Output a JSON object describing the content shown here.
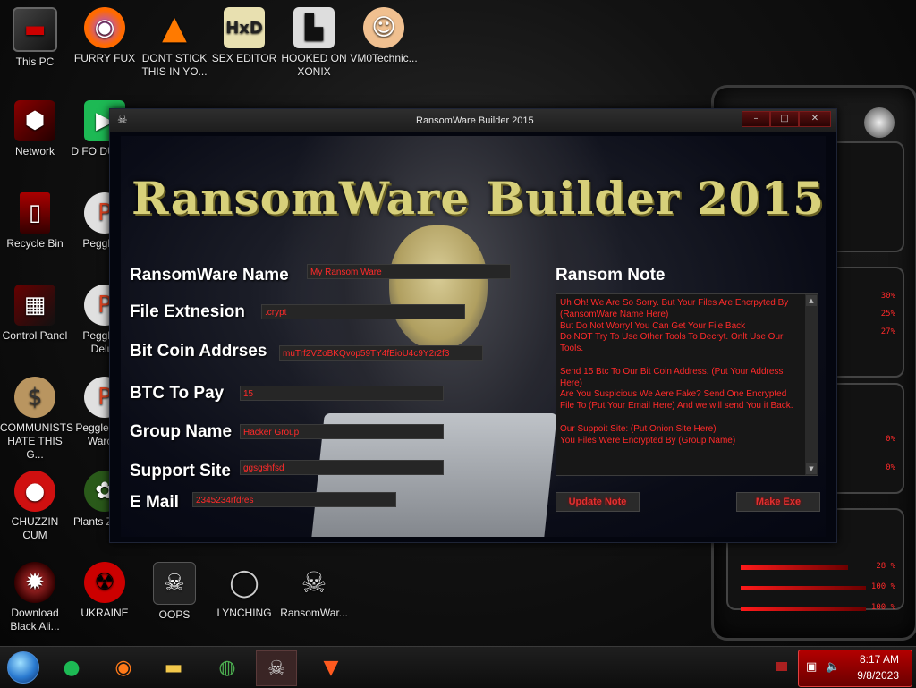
{
  "desktop": {
    "icons": [
      {
        "label": "This PC",
        "icon": "monitor-icon"
      },
      {
        "label": "FURRY FUX",
        "icon": "firefox-icon"
      },
      {
        "label": "DONT STICK THIS IN YO...",
        "icon": "vlc-cone-icon"
      },
      {
        "label": "SEX EDITOR",
        "icon": "hxd-icon"
      },
      {
        "label": "HOOKED ON XONIX",
        "icon": "xonix-icon"
      },
      {
        "label": "VM0Technic...",
        "icon": "doctor-icon"
      },
      {
        "label": "Network",
        "icon": "network-icon"
      },
      {
        "label": "D FO DUMBA",
        "icon": "app-icon"
      },
      {
        "label": "Recycle Bin",
        "icon": "recycle-bin-icon"
      },
      {
        "label": "Peggle D",
        "icon": "peggle-icon"
      },
      {
        "label": "Control Panel",
        "icon": "control-panel-icon"
      },
      {
        "label": "Peggle N Delux",
        "icon": "peggle-icon"
      },
      {
        "label": "COMMUNISTS HATE THIS G...",
        "icon": "money-bag-icon"
      },
      {
        "label": "Peggle W of Warcra",
        "icon": "peggle-icon"
      },
      {
        "label": "CHUZZIN CUM",
        "icon": "chuzzle-icon"
      },
      {
        "label": "Plants Zombi",
        "icon": "plant-icon"
      },
      {
        "label": "Download Black Ali...",
        "icon": "alien-icon"
      },
      {
        "label": "UKRAINE",
        "icon": "radiation-icon"
      },
      {
        "label": "OOPS",
        "icon": "skull-monitor-icon"
      },
      {
        "label": "LYNCHING",
        "icon": "noose-icon"
      },
      {
        "label": "RansomWar...",
        "icon": "skull-icon"
      }
    ]
  },
  "widget": {
    "percents": [
      "30%",
      "25%",
      "27%",
      "0%",
      "0%",
      "28 %",
      "100 %",
      "100 %"
    ]
  },
  "window": {
    "title": "RansomWare Builder 2015",
    "controls": {
      "minimize": "–",
      "maximize": "□",
      "close": "✕"
    },
    "banner": "RansomWare Builder 2015",
    "fields": [
      {
        "label": "RansomWare Name",
        "value": "My Ransom Ware"
      },
      {
        "label": "File Extnesion",
        "value": ".crypt"
      },
      {
        "label": "Bit Coin Addrses",
        "value": "muTrf2VZoBKQvop59TY4fEioU4c9Y2r2f3"
      },
      {
        "label": "BTC To Pay",
        "value": "15"
      },
      {
        "label": "Group Name",
        "value": "Hacker Group"
      },
      {
        "label": "Support Site",
        "value": "ggsgshfsd"
      },
      {
        "label": "E Mail",
        "value": "2345234rfdres"
      }
    ],
    "note_label": "Ransom Note",
    "note_text": "Uh Oh! We Are So Sorry. But Your Files Are Encrpyted By (RansomWare Name Here)\nBut Do Not Worry! You Can Get Your File Back\nDo NOT Try To Use Other Tools To Decryt. Onlt Use Our Tools.\n\nSend 15 Btc To Our Bit Coin Address. (Put Your Address Here)\nAre You Suspicious We Aere Fake? Send One Encrypted File To (Put Your Email Here) And we will send You it Back.\n\nOur Suppoit Site: (Put Onion Site Here)\nYou Files Were Encrypted By (Group Name)",
    "buttons": {
      "update": "Update Note",
      "make": "Make Exe"
    }
  },
  "taskbar": {
    "items": [
      "start-orb-icon",
      "spotify-icon",
      "firefox-icon",
      "file-explorer-icon",
      "chrome-icon",
      "skull-icon",
      "brave-icon"
    ],
    "clock_time": "8:17 AM",
    "clock_date": "9/8/2023"
  }
}
